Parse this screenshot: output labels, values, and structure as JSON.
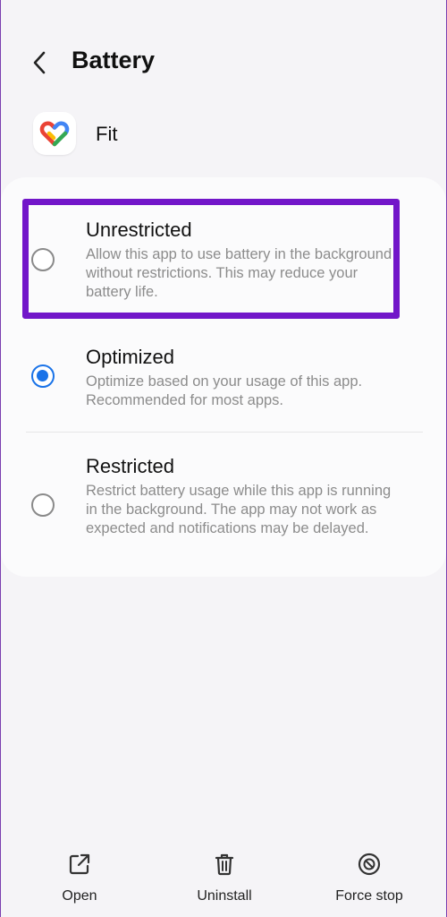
{
  "header": {
    "title": "Battery",
    "back_icon": "back-arrow-icon"
  },
  "app": {
    "name": "Fit",
    "icon": "google-fit-heart-icon"
  },
  "options": [
    {
      "label": "Unrestricted",
      "description": "Allow this app to use battery in the background without restrictions. This may reduce your battery life.",
      "selected": false
    },
    {
      "label": "Optimized",
      "description": "Optimize based on your usage of this app. Recommended for most apps.",
      "selected": true
    },
    {
      "label": "Restricted",
      "description": "Restrict battery usage while this app is running in the background. The app may not work as expected and notifications may be delayed.",
      "selected": false
    }
  ],
  "bottom_actions": [
    {
      "label": "Open",
      "icon": "open-external-icon"
    },
    {
      "label": "Uninstall",
      "icon": "trash-icon"
    },
    {
      "label": "Force stop",
      "icon": "stop-circle-icon"
    }
  ],
  "colors": {
    "accent": "#1a73e8",
    "highlight": "#7216c9",
    "background": "#f5f4f7"
  }
}
